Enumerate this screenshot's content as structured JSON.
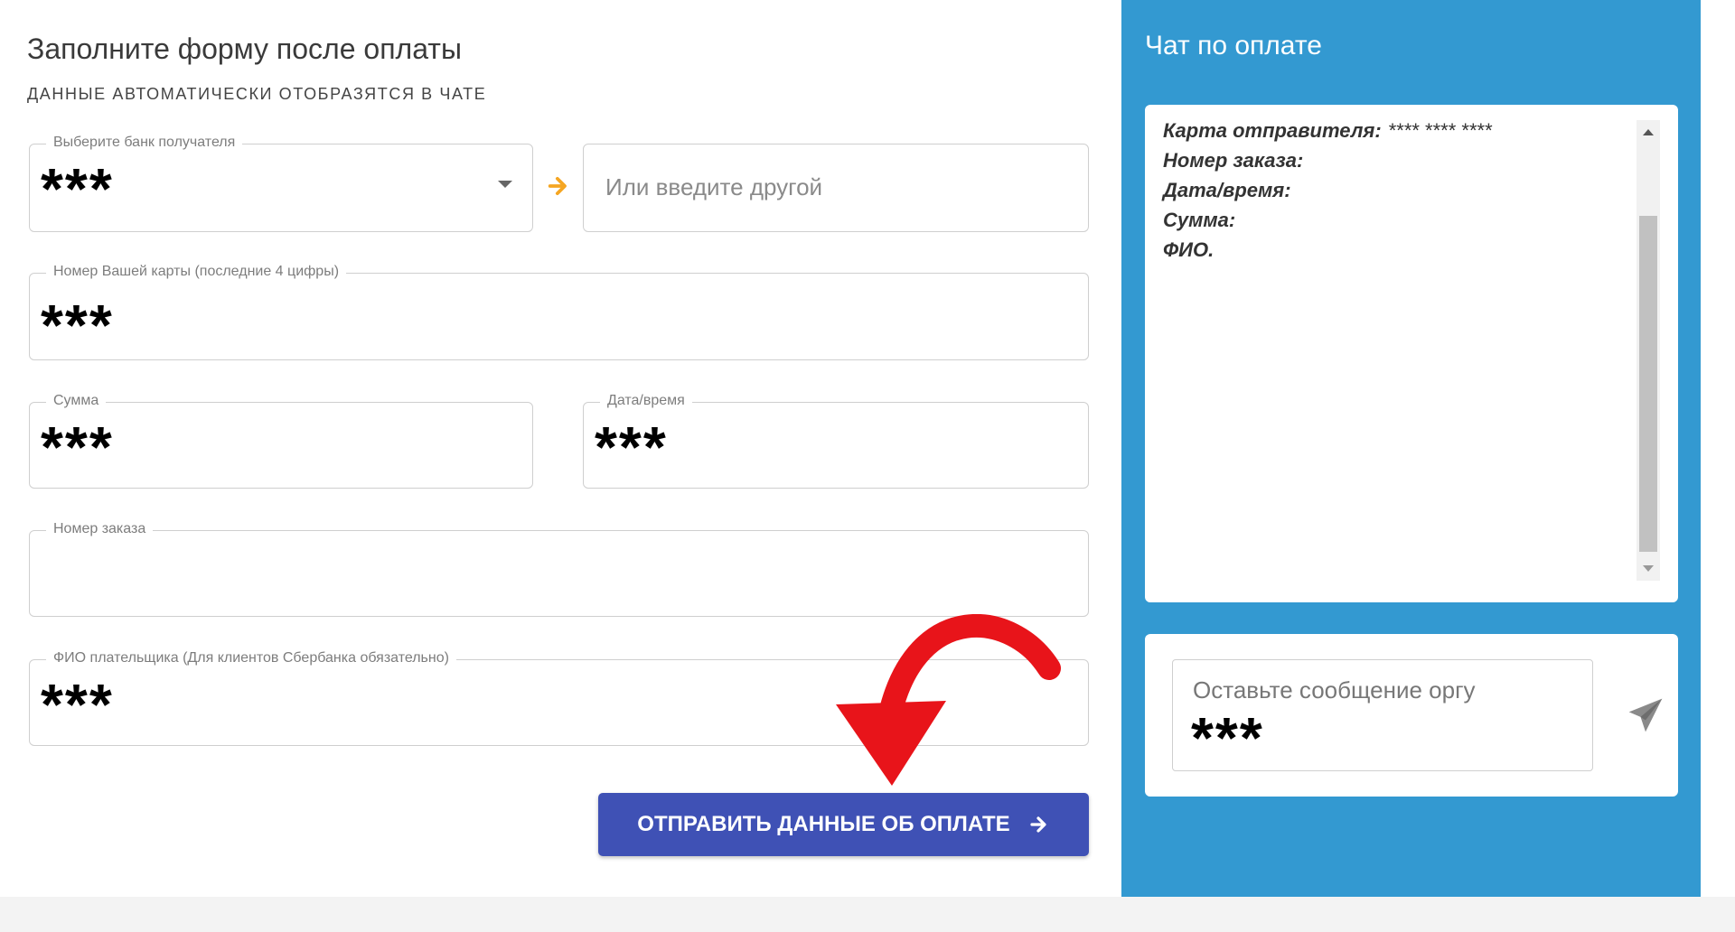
{
  "form": {
    "title": "Заполните форму после оплаты",
    "subtitle": "ДАННЫЕ АВТОМАТИЧЕСКИ ОТОБРАЗЯТСЯ В ЧАТЕ",
    "bank_select": {
      "label": "Выберите банк получателя",
      "value": "***"
    },
    "other_bank": {
      "placeholder": "Или введите другой"
    },
    "card_number": {
      "label": "Номер Вашей карты (последние 4 цифры)",
      "value": "***"
    },
    "amount": {
      "label": "Сумма",
      "value": "***"
    },
    "datetime": {
      "label": "Дата/время",
      "value": "***"
    },
    "order_number": {
      "label": "Номер заказа",
      "value": ""
    },
    "payer_name": {
      "label": "ФИО плательщика (Для клиентов Сбербанка обязательно)",
      "value": "***"
    },
    "submit_label": "ОТПРАВИТЬ ДАННЫЕ ОБ ОПЛАТЕ"
  },
  "chat": {
    "title": "Чат по оплате",
    "lines": {
      "sender_card_label": "Карта отправителя:",
      "sender_card_value": "**** **** ****",
      "order_label": "Номер заказа:",
      "datetime_label": "Дата/время:",
      "amount_label": "Сумма:",
      "name_label": "ФИО."
    },
    "message_placeholder": "Оставьте сообщение оргу",
    "message_value": "***"
  },
  "colors": {
    "chat_background": "#3399d1",
    "submit_button": "#3f51b5",
    "arrow_accent": "#f5a623",
    "annotation_arrow": "#e8141a"
  },
  "icons": {
    "bank_dropdown": "chevron-down-icon",
    "other_bank_hint": "arrow-right-icon",
    "submit": "arrow-right-icon",
    "send": "paper-plane-icon",
    "annotation": "curved-arrow-icon"
  }
}
